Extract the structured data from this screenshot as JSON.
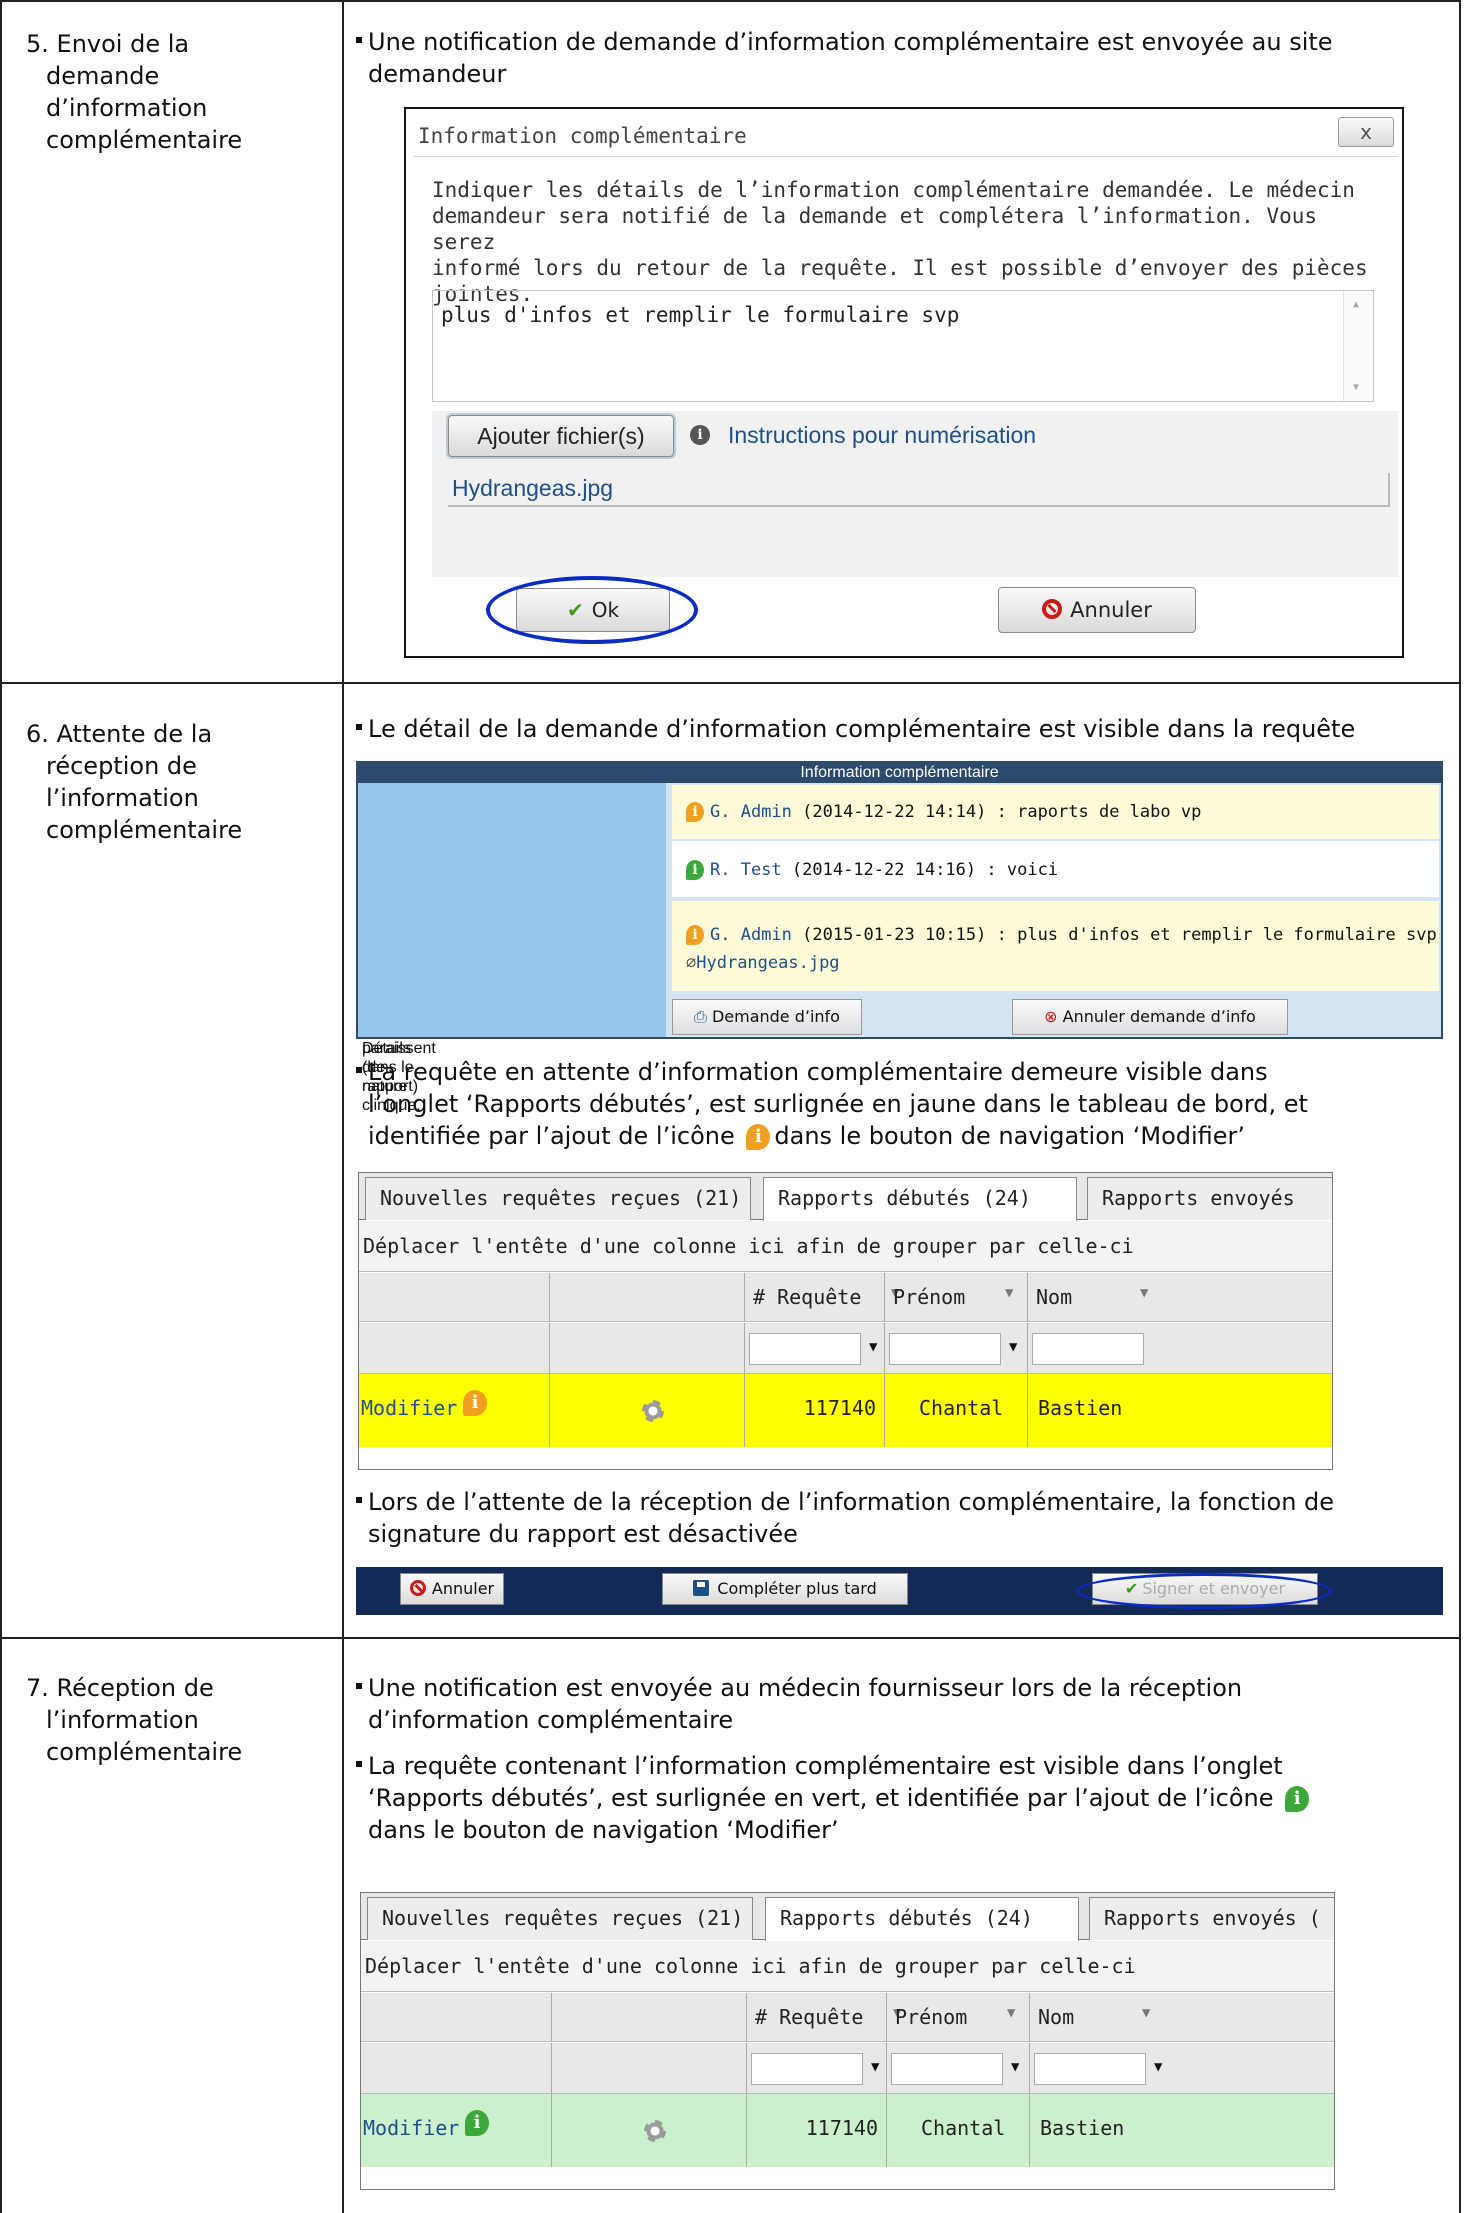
{
  "steps": [
    {
      "num": "5.",
      "label": "Envoi de la demande d’information complémentaire",
      "lines": [
        "Envoi de la",
        "demande",
        "d’information",
        "complémentaire"
      ]
    },
    {
      "num": "6.",
      "label": "Attente de la réception de l’information complémentaire",
      "lines": [
        "Attente de la",
        "réception de",
        "l’information",
        "complémentaire"
      ]
    },
    {
      "num": "7.",
      "label": "Réception de l’information complémentaire",
      "lines": [
        "Réception de",
        "l’information",
        "complémentaire"
      ]
    }
  ],
  "bullets": {
    "b5_1": [
      "Une notification de demande d’information complémentaire est envoyée au site",
      "demandeur"
    ],
    "b6_1": [
      "Le détail de la demande d’information complémentaire est visible dans la requête"
    ],
    "b6_2": [
      "La requête en attente d’information complémentaire demeure visible dans",
      "l’onglet ‘Rapports débutés’, est surlignée en jaune dans  le tableau de bord, et",
      "identifiée par l’ajout de l’icône",
      "dans le bouton de navigation ‘Modifier’"
    ],
    "b6_3": [
      "Lors de l’attente de la réception de l’information complémentaire, la fonction de",
      "signature du rapport est désactivée"
    ],
    "b7_1": [
      "Une notification est envoyée au médecin fournisseur lors de la réception",
      "d’information complémentaire"
    ],
    "b7_2": [
      "La requête contenant l’information complémentaire est visible dans l’onglet",
      "‘Rapports débutés’, est surlignée en vert, et identifiée par l’ajout de l’icône",
      "dans le bouton de navigation ‘Modifier’"
    ]
  },
  "dialog": {
    "title": "Information complémentaire",
    "close_label": "x",
    "message_lines": [
      "Indiquer les détails de l’information complémentaire demandée. Le médecin",
      "demandeur sera notifié de la demande et complétera l’information. Vous serez",
      "informé lors du retour de la requête. Il est possible d’envoyer des pièces jointes."
    ],
    "textarea_value": "plus d'infos et remplir le formulaire svp",
    "add_file_label": "Ajouter fichier(s)",
    "instructions_link": "Instructions pour numérisation",
    "attached_file": "Hydrangeas.jpg",
    "ok_label": "Ok",
    "cancel_label": "Annuler"
  },
  "detail_panel": {
    "title": "Information complémentaire",
    "left_label_lines": [
      "Détails (de nature clinique,",
      "paraissent dans le rapport)"
    ],
    "messages": [
      {
        "who": "G. Admin",
        "when": "(2014-12-22 14:14)",
        "text": ": raports de labo vp",
        "icon": "orange-info-icon"
      },
      {
        "who": "R. Test",
        "when": "(2014-12-22 14:16)",
        "text": ": voici",
        "icon": "green-info-icon"
      },
      {
        "who": "G. Admin",
        "when": "(2015-01-23 10:15)",
        "text": ": plus d'infos et remplir le formulaire svp",
        "icon": "orange-info-icon",
        "attachment": "Hydrangeas.jpg"
      }
    ],
    "button_request": "Demande d’info",
    "button_cancel": "Annuler demande d’info"
  },
  "grid_yellow": {
    "tabs": [
      "Nouvelles requêtes reçues (21)",
      "Rapports débutés (24)",
      "Rapports envoyés"
    ],
    "group_hint": "Déplacer l'entête d'une colonne ici afin de grouper par celle-ci",
    "headers": [
      "# Requête",
      "Prénom",
      "Nom"
    ],
    "row": {
      "action": "Modifier",
      "requete": "117140",
      "prenom": "Chantal",
      "nom": "Bastien"
    },
    "row_color": "#ffff00"
  },
  "grid_green": {
    "tabs": [
      "Nouvelles requêtes reçues (21)",
      "Rapports débutés (24)",
      "Rapports envoyés ("
    ],
    "group_hint": "Déplacer l'entête d'une colonne ici afin de grouper par celle-ci",
    "headers": [
      "# Requête",
      "Prénom",
      "Nom"
    ],
    "row": {
      "action": "Modifier",
      "requete": "117140",
      "prenom": "Chantal",
      "nom": "Bastien"
    },
    "row_color": "#ccf0cc"
  },
  "action_bar": {
    "cancel": "Annuler",
    "later": "Compléter plus tard",
    "sign": "Signer et envoyer"
  }
}
